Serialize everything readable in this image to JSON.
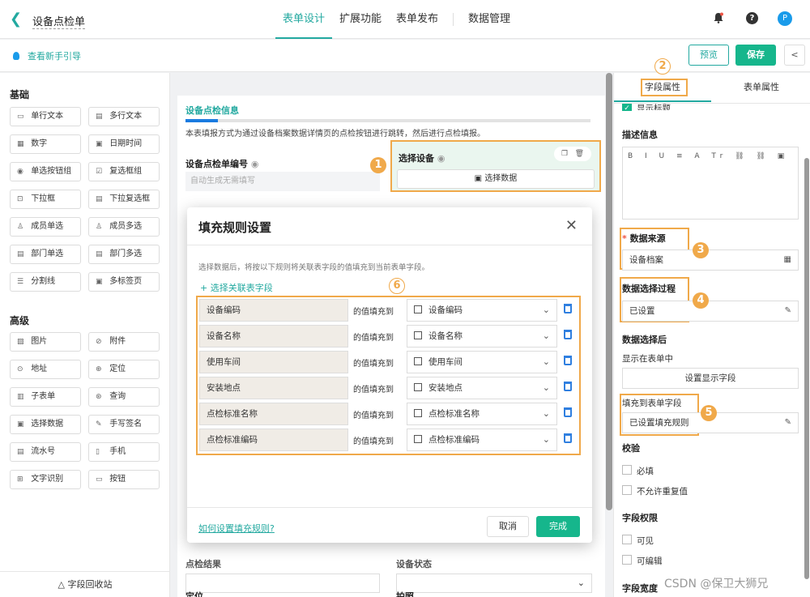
{
  "header": {
    "title": "设备点检单",
    "tabs": [
      "表单设计",
      "扩展功能",
      "表单发布",
      "数据管理"
    ],
    "avatar_letter": "P"
  },
  "subbar": {
    "guide_text": "查看新手引导",
    "preview_label": "预览",
    "save_label": "保存"
  },
  "palette": {
    "basic_title": "基础",
    "basic_items": [
      {
        "label": "单行文本",
        "icon": "text-line-icon"
      },
      {
        "label": "多行文本",
        "icon": "text-multi-icon"
      },
      {
        "label": "数字",
        "icon": "number-icon"
      },
      {
        "label": "日期时间",
        "icon": "calendar-icon"
      },
      {
        "label": "单选按钮组",
        "icon": "radio-icon"
      },
      {
        "label": "复选框组",
        "icon": "checkbox-icon"
      },
      {
        "label": "下拉框",
        "icon": "dropdown-icon"
      },
      {
        "label": "下拉复选框",
        "icon": "dropdown-multi-icon"
      },
      {
        "label": "成员单选",
        "icon": "member-icon"
      },
      {
        "label": "成员多选",
        "icon": "members-icon"
      },
      {
        "label": "部门单选",
        "icon": "dept-icon"
      },
      {
        "label": "部门多选",
        "icon": "depts-icon"
      },
      {
        "label": "分割线",
        "icon": "divider-icon"
      },
      {
        "label": "多标签页",
        "icon": "tabs-icon"
      }
    ],
    "advanced_title": "高级",
    "advanced_items": [
      {
        "label": "图片",
        "icon": "image-icon"
      },
      {
        "label": "附件",
        "icon": "attachment-icon"
      },
      {
        "label": "地址",
        "icon": "location-icon"
      },
      {
        "label": "定位",
        "icon": "crosshair-icon"
      },
      {
        "label": "子表单",
        "icon": "subform-icon"
      },
      {
        "label": "查询",
        "icon": "query-icon"
      },
      {
        "label": "选择数据",
        "icon": "select-data-icon"
      },
      {
        "label": "手写签名",
        "icon": "signature-icon"
      },
      {
        "label": "流水号",
        "icon": "serial-icon"
      },
      {
        "label": "手机",
        "icon": "phone-icon"
      },
      {
        "label": "文字识别",
        "icon": "ocr-icon"
      },
      {
        "label": "按钮",
        "icon": "button-icon"
      }
    ],
    "recycle_label": "字段回收站"
  },
  "canvas": {
    "section_title": "设备点检信息",
    "section_desc": "本表填报方式为通过设备档案数据详情页的点检按钮进行跳转，然后进行点检填报。",
    "field_no_label": "设备点检单编号",
    "field_no_placeholder": "自动生成无需填写",
    "select_label": "选择设备",
    "select_button": "选择数据",
    "bottom_left_label": "点检结果",
    "bottom_right_label": "设备状态",
    "bottom2_left_label": "定位",
    "bottom2_right_label": "拍照"
  },
  "modal": {
    "title": "填充规则设置",
    "desc": "选择数据后，将按以下规则将关联表字段的值填充到当前表单字段。",
    "add_label": "+ 选择关联表字段",
    "mid_text": "的值填充到",
    "rules": [
      {
        "src": "设备编码",
        "dst": "设备编码"
      },
      {
        "src": "设备名称",
        "dst": "设备名称"
      },
      {
        "src": "使用车间",
        "dst": "使用车间"
      },
      {
        "src": "安装地点",
        "dst": "安装地点"
      },
      {
        "src": "点检标准名称",
        "dst": "点检标准名称"
      },
      {
        "src": "点检标准编码",
        "dst": "点检标准编码"
      }
    ],
    "help_link": "如何设置填充规则?",
    "cancel_label": "取消",
    "ok_label": "完成"
  },
  "right": {
    "tab_field": "字段属性",
    "tab_form": "表单属性",
    "show_title": "显示标题",
    "desc_label": "描述信息",
    "editor_tools": "B I U ≡ A Tr ⛓ ⛓ ▣",
    "source_label": "数据来源",
    "source_value": "设备档案",
    "process_label": "数据选择过程",
    "process_value": "已设置",
    "after_label": "数据选择后",
    "show_in_form": "显示在表单中",
    "display_fields_btn": "设置显示字段",
    "fill_label": "填充到表单字段",
    "fill_value": "已设置填充规则",
    "validate_label": "校验",
    "required_label": "必填",
    "no_dup_label": "不允许重复值",
    "perm_label": "字段权限",
    "visible_label": "可见",
    "editable_label": "可编辑",
    "width_label": "字段宽度"
  },
  "badges": [
    "1",
    "2",
    "3",
    "4",
    "5",
    "6"
  ],
  "watermark": "CSDN @保卫大狮兄",
  "colors": {
    "accent": "#23a9a0",
    "primary_btn": "#16b68c",
    "highlight": "#f0a94a",
    "delete": "#2f7fe0"
  }
}
